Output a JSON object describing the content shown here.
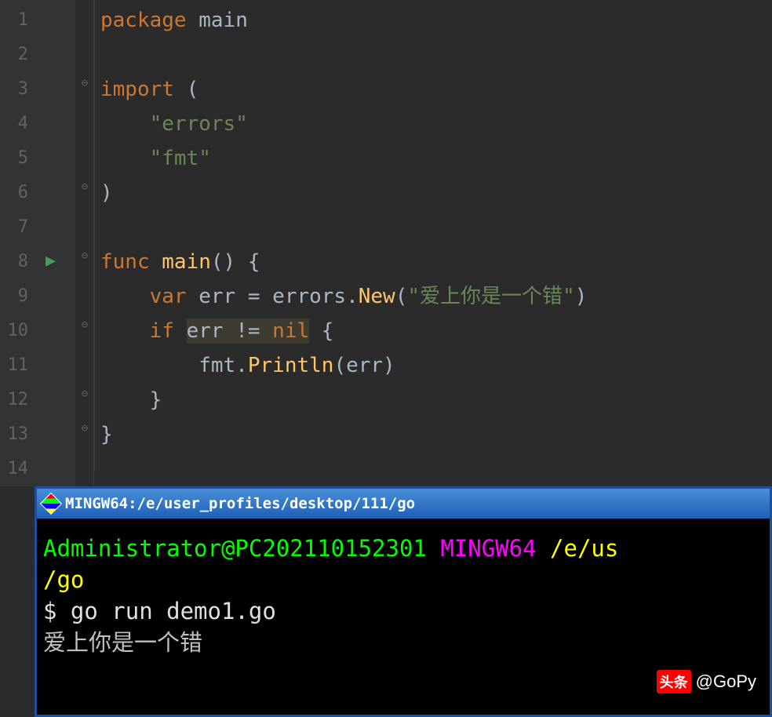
{
  "editor": {
    "lines": [
      "1",
      "2",
      "3",
      "4",
      "5",
      "6",
      "7",
      "8",
      "9",
      "10",
      "11",
      "12",
      "13",
      "14"
    ],
    "code": {
      "l1": {
        "indent": "",
        "tokens": [
          {
            "t": "package ",
            "c": "kw"
          },
          {
            "t": "main",
            "c": "id"
          }
        ]
      },
      "l2": {
        "indent": "",
        "tokens": []
      },
      "l3": {
        "indent": "",
        "tokens": [
          {
            "t": "import ",
            "c": "kw"
          },
          {
            "t": "(",
            "c": "id"
          }
        ]
      },
      "l4": {
        "indent": "    ",
        "tokens": [
          {
            "t": "\"errors\"",
            "c": "str"
          }
        ]
      },
      "l5": {
        "indent": "    ",
        "tokens": [
          {
            "t": "\"fmt\"",
            "c": "str"
          }
        ]
      },
      "l6": {
        "indent": "",
        "tokens": [
          {
            "t": ")",
            "c": "id"
          }
        ]
      },
      "l7": {
        "indent": "",
        "tokens": []
      },
      "l8": {
        "indent": "",
        "tokens": [
          {
            "t": "func ",
            "c": "kw"
          },
          {
            "t": "main",
            "c": "fn"
          },
          {
            "t": "() {",
            "c": "id"
          }
        ]
      },
      "l9": {
        "indent": "    ",
        "tokens": [
          {
            "t": "var ",
            "c": "kw"
          },
          {
            "t": "err = errors.",
            "c": "id"
          },
          {
            "t": "New",
            "c": "fn"
          },
          {
            "t": "(",
            "c": "id"
          },
          {
            "t": "\"爱上你是一个错\"",
            "c": "str"
          },
          {
            "t": ")",
            "c": "id"
          }
        ]
      },
      "l10": {
        "indent": "    ",
        "tokens": [
          {
            "t": "if ",
            "c": "kw"
          },
          {
            "t": "err != ",
            "c": "id",
            "hl": true
          },
          {
            "t": "nil",
            "c": "kw",
            "hl": true
          },
          {
            "t": " {",
            "c": "id"
          }
        ]
      },
      "l11": {
        "indent": "        ",
        "tokens": [
          {
            "t": "fmt.",
            "c": "id"
          },
          {
            "t": "Println",
            "c": "fn"
          },
          {
            "t": "(err)",
            "c": "id"
          }
        ]
      },
      "l12": {
        "indent": "    ",
        "tokens": [
          {
            "t": "}",
            "c": "id"
          }
        ]
      },
      "l13": {
        "indent": "",
        "tokens": [
          {
            "t": "}",
            "c": "id"
          }
        ]
      },
      "l14": {
        "indent": "",
        "tokens": []
      }
    }
  },
  "terminal": {
    "title": "MINGW64:/e/user_profiles/desktop/111/go",
    "prompt_user": "Administrator@PC202110152301",
    "prompt_env": "MINGW64",
    "prompt_path1": "/e/us",
    "prompt_path2": "/go",
    "prompt_symbol": "$ ",
    "command": "go run demo1.go",
    "output": "爱上你是一个错"
  },
  "watermark": {
    "logo": "头条",
    "text": "@GoPy"
  }
}
